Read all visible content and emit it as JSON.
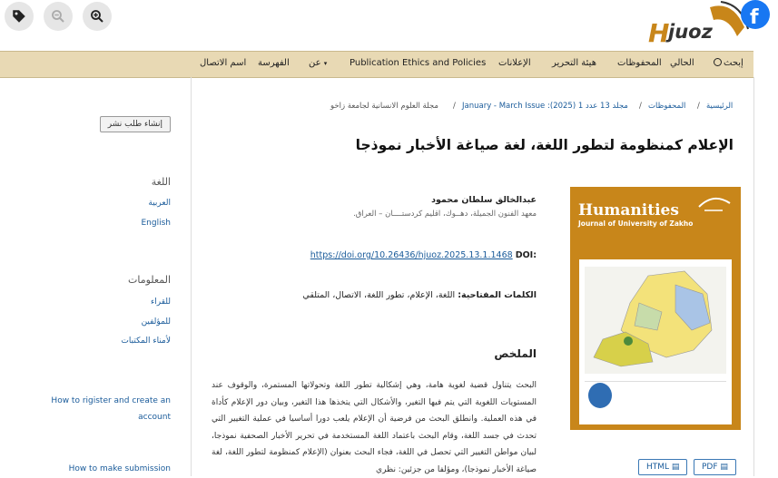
{
  "toolbar": {
    "tag_icon": "tag-icon",
    "zoom_out_icon": "zoom-out-icon",
    "zoom_in_icon": "zoom-in-icon"
  },
  "logo": {
    "text": "Hjuoz"
  },
  "nav": {
    "search": "إبحث",
    "current": "الحالي",
    "archives": "المحفوظات",
    "editorial_board": "هيئة التحرير",
    "announcements": "الإعلانات",
    "ethics": "Publication Ethics and Policies",
    "about": "عن",
    "indexing": "الفهرسة",
    "contact": "اسم الاتصال"
  },
  "sidebar": {
    "submit_button": "إنشاء طلب نشر",
    "language_heading": "اللغة",
    "lang_arabic": "العربية",
    "lang_english": "English",
    "info_heading": "المعلومات",
    "info_readers": "للقراء",
    "info_authors": "للمؤلفين",
    "info_librarians": "لأمناء المكتبات",
    "link_register": "How to rigister and create an account",
    "link_submission": "How to make submission"
  },
  "breadcrumb": {
    "home": "الرئيسية",
    "archives": "المحفوظات",
    "issue": "مجلد 13 عدد 1 (2025): January - March Issue",
    "journal": "مجلة العلوم الانسانية لجامعة زاخو"
  },
  "article": {
    "title": "الإعلام كمنظومة لتطور اللغة، لغة صياغة الأخبار نموذجا",
    "author_name": "عبدالخالق سلطان محمود",
    "affiliation": "معهد الفنون الجميلة، دهــوك، اقليم كردستــــان – العراق.",
    "doi_label": "DOI:",
    "doi_url": "https://doi.org/10.26436/hjuoz.2025.13.1.1468",
    "keywords_label": "الكلمات المفتاحية:",
    "keywords": "اللغة، الإعلام، تطور اللغة، الاتصال، المتلقي",
    "abstract_heading": "الملخص",
    "abstract_text": "البحث يتناول قضية لغوية هامة، وهي إشكالية تطور اللغة وتحولاتها المستمرة، والوقوف عند المستويات اللغوية التي يتم فيها التغير، والأشكال التي يتخذها هذا التغير، وبيان دور الإعلام كأداة في هذه العملية. وانطلق البحث من فرضية أن الإعلام يلعب دورا أساسيا في عملية التغيير التي تحدث في جسد اللغة، وقام البحث باعتماد اللغة المستخدمة في تحرير الأخبار الصحفية نموذجا، لبيان مواطن التغيير التي تحصل في اللغة، فجاء البحث بعنوان (الإعلام كمنظومة لتطور اللغة، لغة صياغة الأخبار نموذجا)، ومؤلفا من جزئين: نظري"
  },
  "cover": {
    "title": "Humanities",
    "subtitle": "Journal of University of Zakho"
  },
  "galleys": {
    "pdf": "PDF",
    "html": "HTML"
  },
  "colors": {
    "navbar": "#e8d9b4",
    "link": "#1a5b9a",
    "cover": "#c8861a"
  }
}
